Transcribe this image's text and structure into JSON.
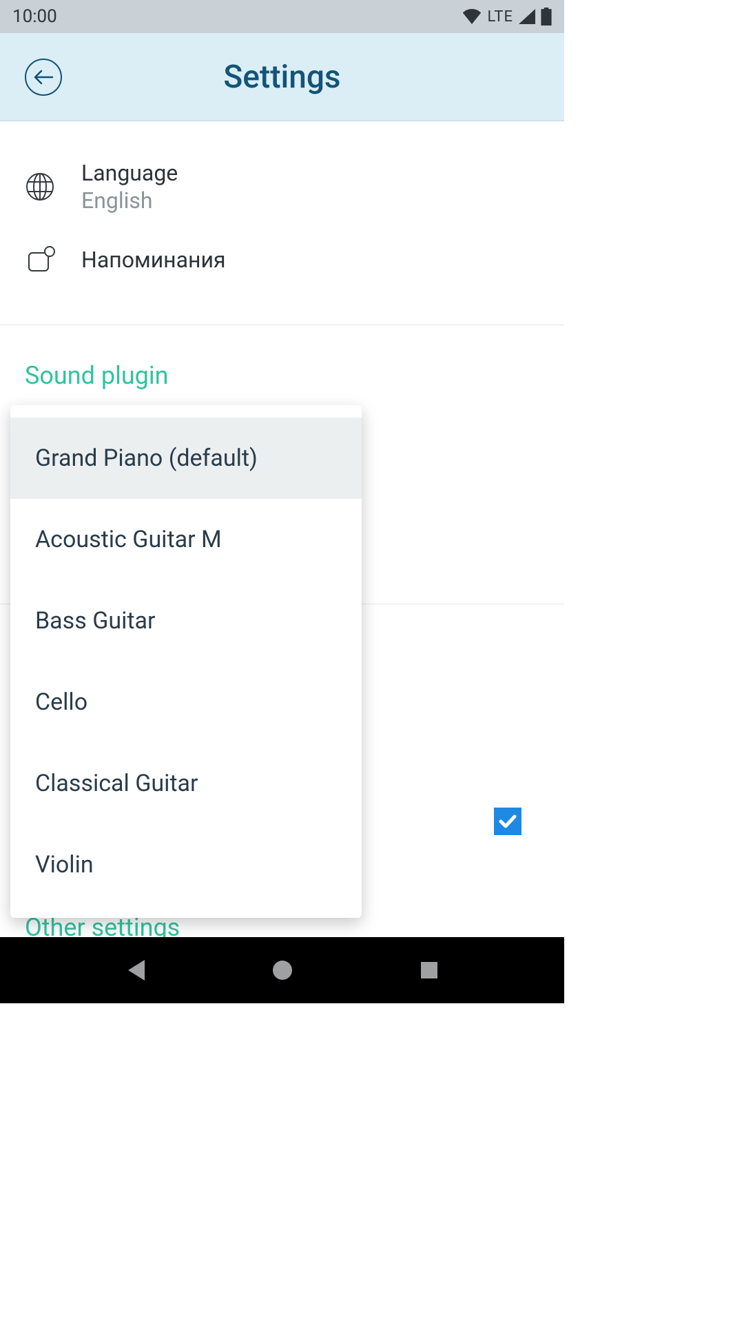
{
  "status_bar": {
    "time": "10:00",
    "network_label": "LTE"
  },
  "header": {
    "title": "Settings"
  },
  "settings": {
    "language": {
      "label": "Language",
      "value": "English"
    },
    "reminders": {
      "label": "Напоминания"
    }
  },
  "sections": {
    "sound_plugin": "Sound plugin",
    "other_settings": "Other settings"
  },
  "dropdown": {
    "items": [
      "Grand Piano (default)",
      "Acoustic Guitar M",
      "Bass Guitar",
      "Cello",
      "Classical Guitar",
      "Violin"
    ],
    "selected_index": 0
  },
  "checkbox_checked": true
}
